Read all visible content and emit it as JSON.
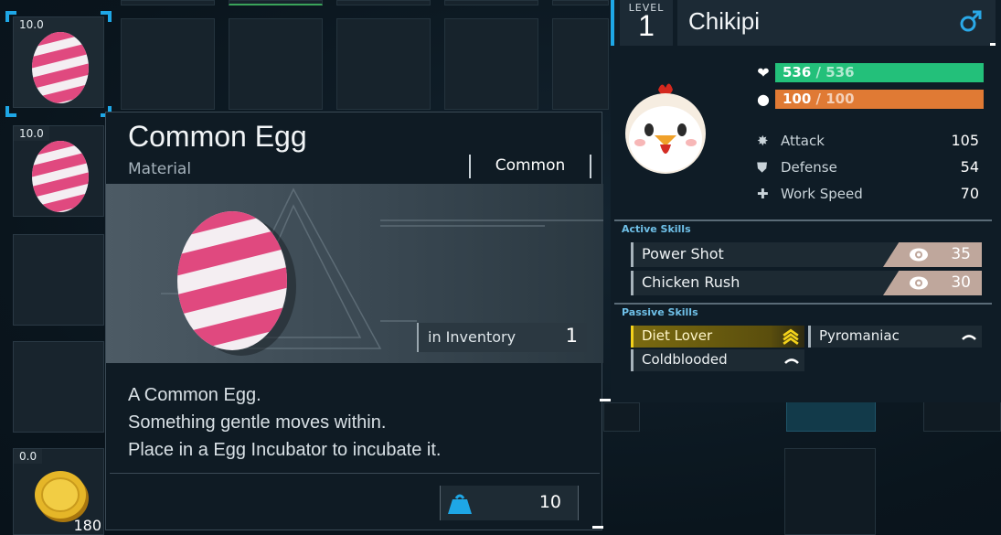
{
  "inventory": {
    "slots": [
      {
        "weight": "10.0",
        "item": "egg",
        "selected": true
      },
      {
        "weight": "10.0",
        "item": "egg",
        "selected": false
      },
      {
        "weight": "",
        "item": "",
        "selected": false
      },
      {
        "weight": "",
        "item": "",
        "selected": false
      },
      {
        "weight": "0.0",
        "item": "gold-coin",
        "count": "180",
        "selected": false
      }
    ]
  },
  "tooltip": {
    "title": "Common Egg",
    "type": "Material",
    "rarity": "Common",
    "in_inventory_label": "in Inventory",
    "in_inventory_value": "1",
    "description": [
      "A Common Egg.",
      "Something gentle moves within.",
      "Place in a Egg Incubator to incubate it."
    ],
    "weight_value": "10",
    "weight_icon": "weight-icon"
  },
  "pal": {
    "level_label": "LEVEL",
    "level": "1",
    "name": "Chikipi",
    "gender_icon": "male-icon",
    "hp_current": "536",
    "hp_max": "536",
    "hp_fraction": 1.0,
    "sp_current": "100",
    "sp_max": "100",
    "sp_fraction": 1.0,
    "colors": {
      "hp": "#23c07a",
      "sp": "#e07a34",
      "accent": "#1ea7e6",
      "gold": "#f3d21b"
    },
    "stats": [
      {
        "icon": "attack-icon",
        "label": "Attack",
        "value": "105"
      },
      {
        "icon": "defense-icon",
        "label": "Defense",
        "value": "54"
      },
      {
        "icon": "work-speed-icon",
        "label": "Work Speed",
        "value": "70"
      }
    ],
    "active_skills_header": "Active Skills",
    "active_skills": [
      {
        "name": "Power Shot",
        "power": "35"
      },
      {
        "name": "Chicken Rush",
        "power": "30"
      }
    ],
    "passive_skills_header": "Passive Skills",
    "passive_skills": [
      {
        "name": "Diet Lover",
        "rank": "gold"
      },
      {
        "name": "Pyromaniac",
        "rank": "normal"
      },
      {
        "name": "Coldblooded",
        "rank": "normal"
      }
    ]
  }
}
